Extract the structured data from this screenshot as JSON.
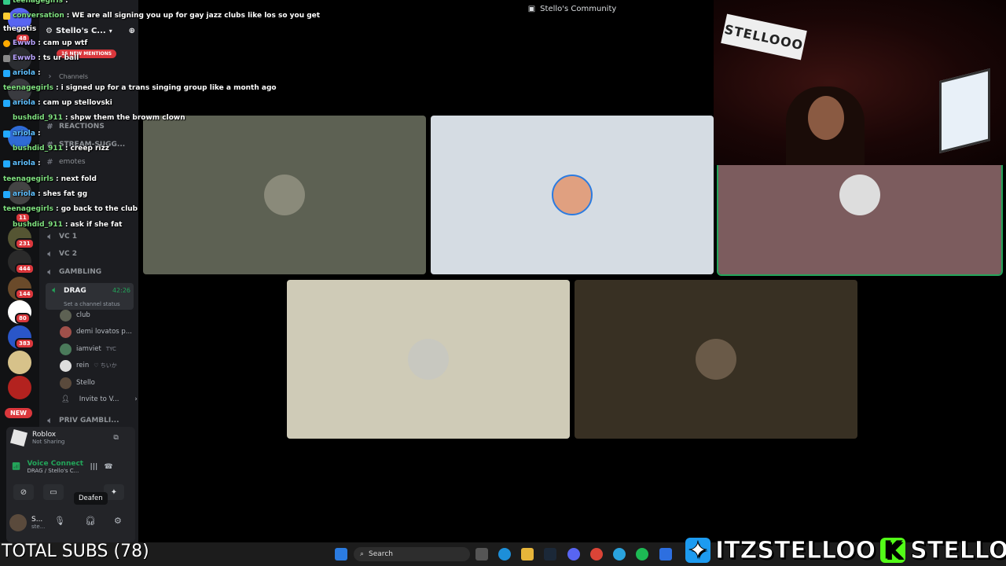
{
  "window": {
    "title": "Stello's Community"
  },
  "server": {
    "name": "Stello's C...",
    "mentions_label": "16 NEW MENTIONS",
    "new_badge": "NEW"
  },
  "rail_badges": [
    "48",
    "11",
    "231",
    "444",
    "144",
    "80",
    "383"
  ],
  "channels": {
    "channels_cat": "Channels",
    "reactions": "REACTIONS",
    "stream_sugg": "STREAM-SUGG...",
    "emotes": "emotes",
    "vc1": "VC 1",
    "vc2": "VC 2",
    "gambling": "GAMBLING",
    "drag_name": "DRAG",
    "drag_time": "42:26",
    "drag_status": "Set a channel status",
    "priv": "PRIV GAMBLI..."
  },
  "voice_users": [
    {
      "name": "club",
      "tag": ""
    },
    {
      "name": "demi lovatos p...",
      "tag": ""
    },
    {
      "name": "iamviet",
      "tag": "TYC"
    },
    {
      "name": "rein",
      "tag": "♡ ちいか"
    },
    {
      "name": "Stello",
      "tag": ""
    }
  ],
  "invite_label": "Invite to V...",
  "activity": {
    "title": "Roblox",
    "status": "Not Sharing"
  },
  "voice": {
    "title": "Voice Connected",
    "sub": "DRAG / Stello's C..."
  },
  "tooltip": "Deafen",
  "user": {
    "name": "S...",
    "sub": "ste..."
  },
  "chat": [
    {
      "user": "teenagegirls",
      "text": "",
      "color": "#56d35a"
    },
    {
      "user": "conversation",
      "text": "WE are all signing you up for gay jazz clubs like los so you get",
      "color": "#7fe07f"
    },
    {
      "user": "thegotis",
      "text": "",
      "color": "#ffffff"
    },
    {
      "user": "Ewwb",
      "text": "cam up wtf",
      "color": "#b9a3ff"
    },
    {
      "user": "Ewwb",
      "text": "ts ur ball",
      "color": "#b9a3ff"
    },
    {
      "user": "ariola",
      "text": "",
      "color": "#5fc0ff"
    },
    {
      "user": "teenagegirls",
      "text": "i signed up for a trans singing group like a month ago",
      "color": "#7fe07f"
    },
    {
      "user": "ariola",
      "text": "cam up stellovski",
      "color": "#5fc0ff"
    },
    {
      "user": "bushdid_911",
      "text": "shpw them the browm clown",
      "color": "#7fe07f"
    },
    {
      "user": "ariola",
      "text": "",
      "color": "#5fc0ff"
    },
    {
      "user": "bushdid_911",
      "text": "creep rizz",
      "color": "#7fe07f"
    },
    {
      "user": "ariola",
      "text": "",
      "color": "#5fc0ff"
    },
    {
      "user": "teenagegirls",
      "text": "next fold",
      "color": "#7fe07f"
    },
    {
      "user": "ariola",
      "text": "shes fat gg",
      "color": "#5fc0ff"
    },
    {
      "user": "teenagegirls",
      "text": "go back to the club",
      "color": "#7fe07f"
    },
    {
      "user": "bushdid_911",
      "text": "ask if she fat",
      "color": "#7fe07f"
    }
  ],
  "tiles": [
    {
      "name": "club",
      "bg": "#5d6153",
      "speaking": false
    },
    {
      "name": "Stello",
      "bg": "#d5dce3",
      "speaking": false
    },
    {
      "name": "demi",
      "bg": "#7c5c5e",
      "speaking": true
    },
    {
      "name": "rein",
      "bg": "#cfcbb7",
      "speaking": false
    },
    {
      "name": "iamviet",
      "bg": "#383023",
      "speaking": false
    }
  ],
  "cam_sign": "STELLOOO",
  "overlay": {
    "subs": "TOTAL SUBS (78)",
    "twitter": "ITZSTELLOO",
    "kick": "STELLOOO"
  },
  "taskbar": {
    "search": "Search"
  }
}
